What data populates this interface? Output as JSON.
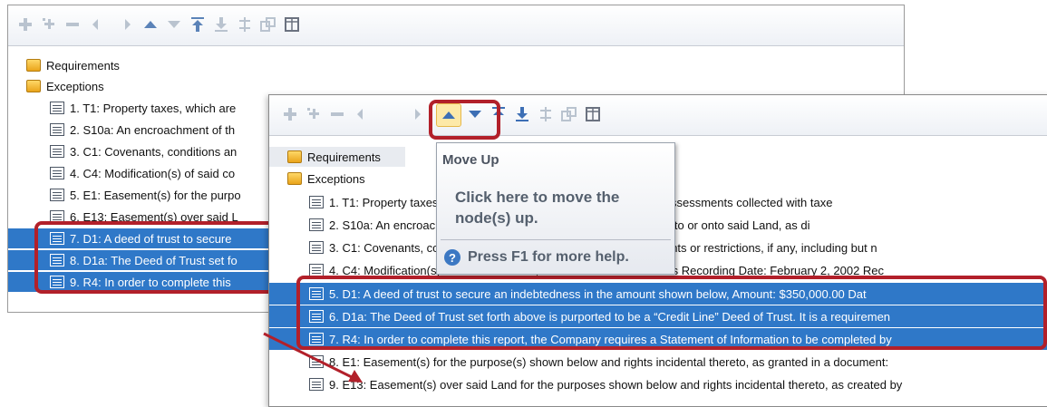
{
  "colors": {
    "selection": "#2f78c8",
    "highlight": "#b2202a",
    "folder": "#f2b630"
  },
  "toolbar_icons": [
    "add-icon",
    "add-child-icon",
    "remove-icon",
    "move-left-icon",
    "move-right-icon",
    "move-up-icon",
    "move-down-icon",
    "move-top-icon",
    "move-bottom-icon",
    "disabled-icon",
    "copy-icon",
    "layout-icon"
  ],
  "back_window": {
    "folders": [
      "Requirements",
      "Exceptions"
    ],
    "items": [
      "1. T1: Property taxes, which are",
      "2. S10a: An encroachment of th",
      "3. C1: Covenants, conditions an",
      "4. C4: Modification(s) of said co",
      "5. E1: Easement(s) for the purpo",
      "6. E13: Easement(s) over said L",
      "7. D1: A deed of trust to secure",
      "8. D1a: The Deed of Trust set fo",
      "9. R4: In order to complete this"
    ]
  },
  "front_window": {
    "folders": [
      "Requirements",
      "Exceptions"
    ],
    "items": [
      "1. T1: Property taxes, which are due and payable, including any assessments collected with taxe",
      "2. S10a: An encroachment of the land adjoining to the northeast into or onto said Land, as di",
      "3. C1: Covenants, conditions and restrictions omitting any covenants or restrictions, if any, including but n",
      "4. C4: Modification(s) of said covenants, conditions and restrictions   Recording Date:  February 2, 2002  Rec",
      "5. D1: A deed of trust to secure an indebtedness in the amount shown below,     Amount:  $350,000.00   Dat",
      "6. D1a: The Deed of Trust set forth above is purported to be a “Credit Line” Deed of Trust.  It is a requiremen",
      "7. R4: In order to complete this report, the Company requires a Statement of Information to be completed by",
      "8. E1: Easement(s) for the purpose(s) shown below and rights incidental thereto, as granted in a document:",
      "9. E13: Easement(s) over said Land for the purposes shown below and rights incidental thereto, as created by"
    ]
  },
  "tooltip": {
    "title": "Move Up",
    "body": "Click here to move the node(s) up.",
    "help": "Press F1 for more help."
  }
}
